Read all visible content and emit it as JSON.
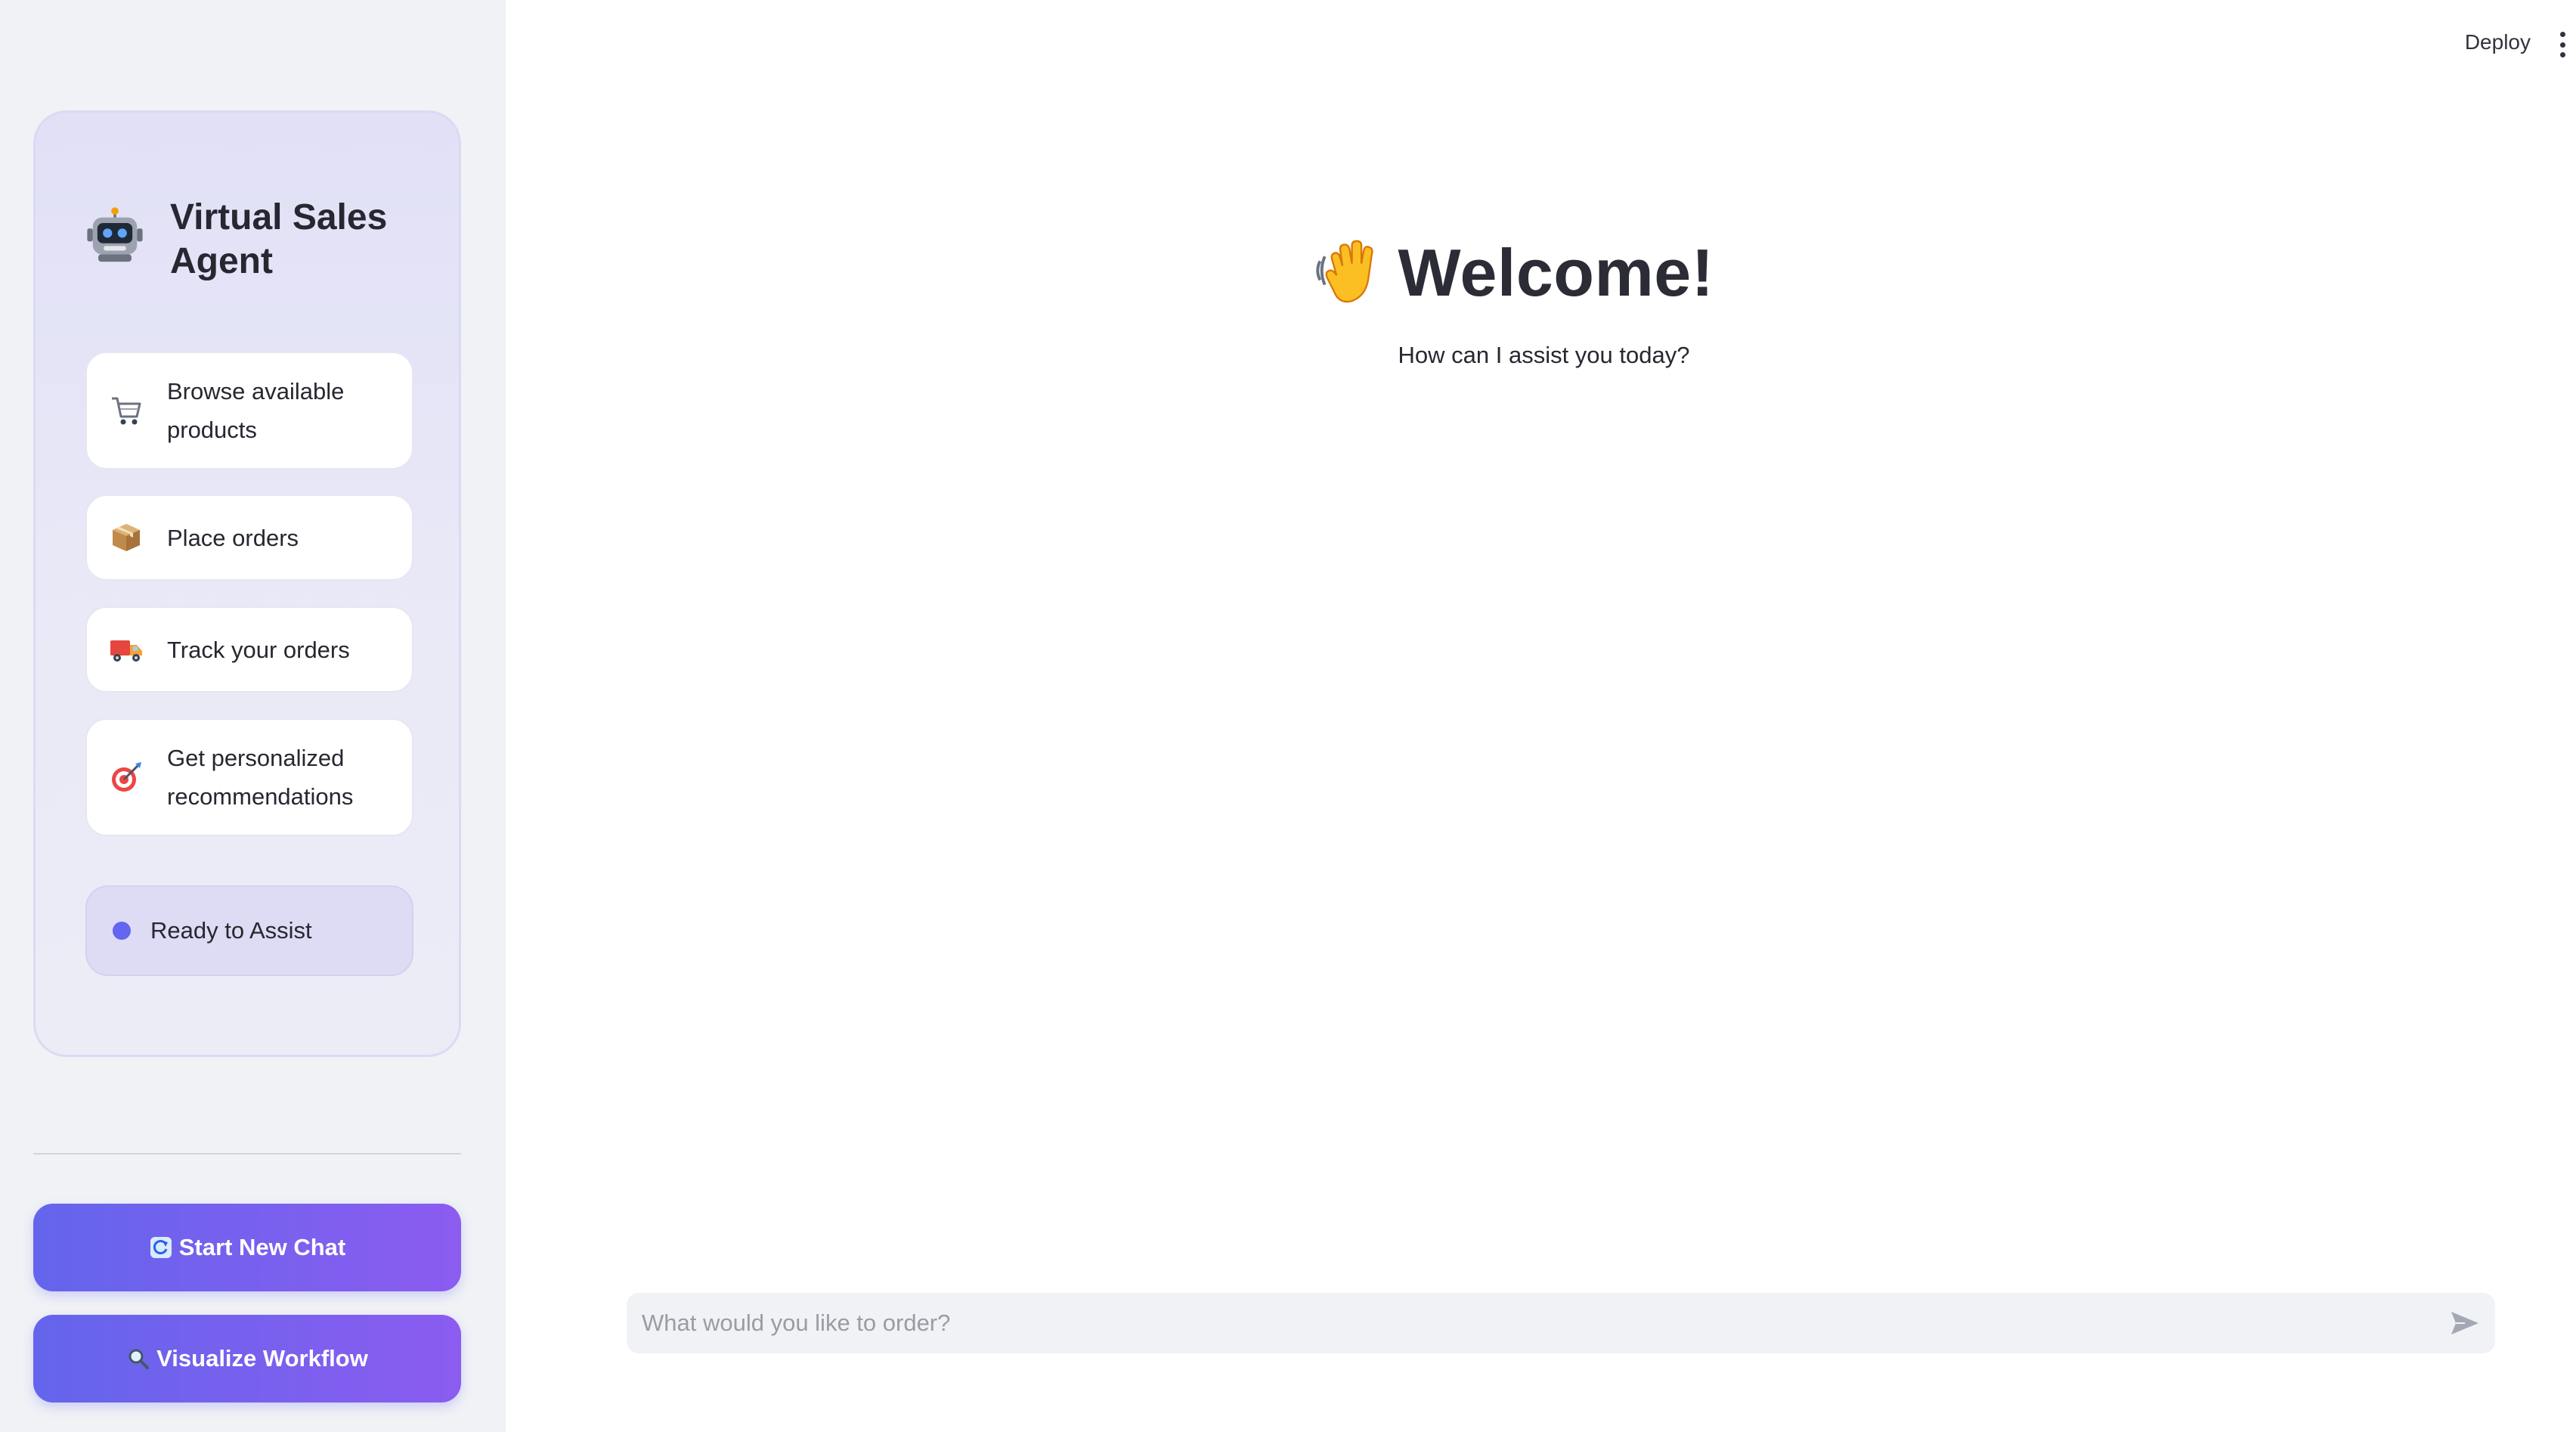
{
  "header": {
    "deploy_label": "Deploy"
  },
  "sidebar": {
    "agent_title": "Virtual Sales Agent",
    "features": [
      {
        "label": "Browse available products",
        "icon": "shopping-cart-icon"
      },
      {
        "label": "Place orders",
        "icon": "package-icon"
      },
      {
        "label": "Track your orders",
        "icon": "delivery-truck-icon"
      },
      {
        "label": "Get personalized recommendations",
        "icon": "target-icon"
      }
    ],
    "status": "Ready to Assist",
    "buttons": {
      "new_chat": "Start New Chat",
      "visualize": "Visualize Workflow"
    }
  },
  "main": {
    "welcome_title": "Welcome!",
    "subtitle": "How can I assist you today?",
    "input_placeholder": "What would you like to order?"
  },
  "colors": {
    "accent": "#6366f1",
    "accent_end": "#8b5cf0",
    "sidebar_bg": "#f0f2f6"
  }
}
